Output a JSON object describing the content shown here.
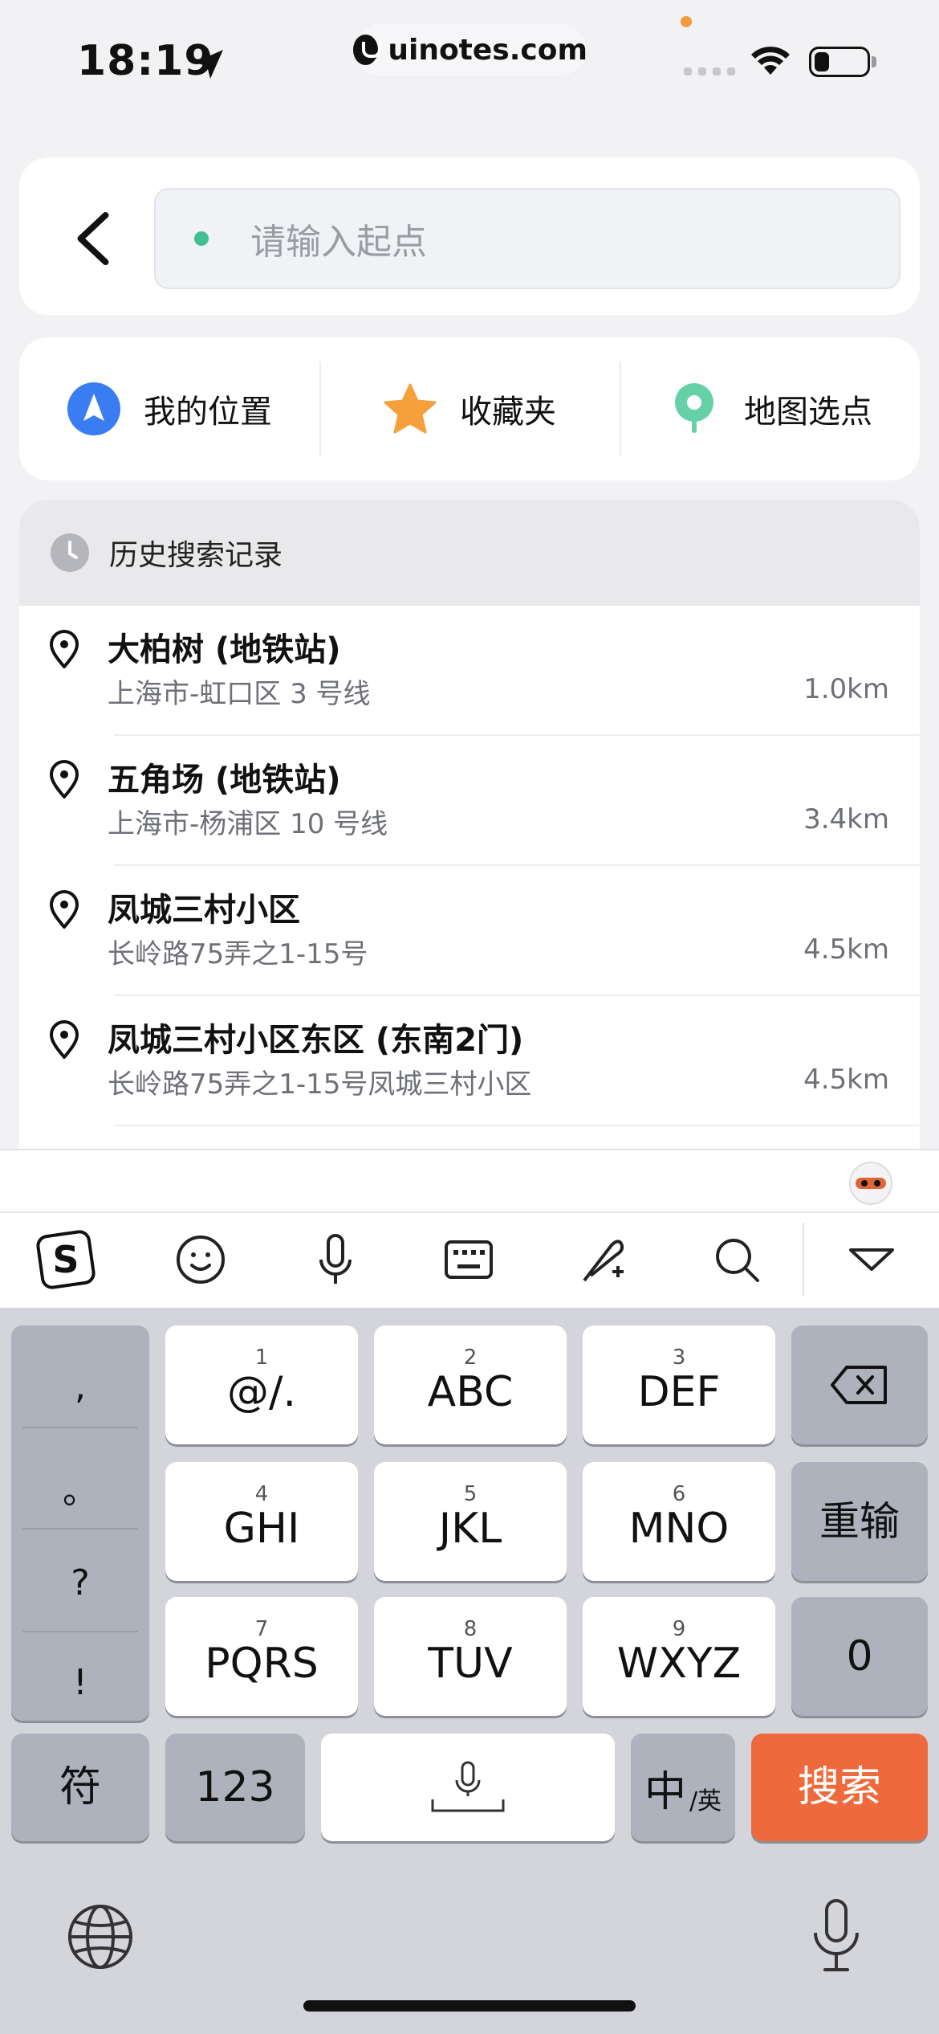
{
  "status_bar": {
    "time": "18:19",
    "url": "uinotes.com"
  },
  "search": {
    "placeholder": "请输入起点"
  },
  "quick_options": [
    {
      "label": "我的位置",
      "icon": "navigation-arrow-icon"
    },
    {
      "label": "收藏夹",
      "icon": "star-icon"
    },
    {
      "label": "地图选点",
      "icon": "map-pin-select-icon"
    }
  ],
  "history": {
    "title": "历史搜索记录",
    "items": [
      {
        "title": "大柏树 (地铁站)",
        "subtitle": "上海市-虹口区 3 号线",
        "distance": "1.0km"
      },
      {
        "title": "五角场 (地铁站)",
        "subtitle": "上海市-杨浦区 10 号线",
        "distance": "3.4km"
      },
      {
        "title": "凤城三村小区",
        "subtitle": "长岭路75弄之1-15号",
        "distance": "4.5km"
      },
      {
        "title": "凤城三村小区东区 (东南2门)",
        "subtitle": "长岭路75弄之1-15号凤城三村小区",
        "distance": "4.5km"
      }
    ]
  },
  "keyboard": {
    "punctuation": [
      ",",
      "。",
      "?",
      "!"
    ],
    "keys": [
      {
        "num": "1",
        "label": "@/."
      },
      {
        "num": "2",
        "label": "ABC"
      },
      {
        "num": "3",
        "label": "DEF"
      },
      {
        "num": "4",
        "label": "GHI"
      },
      {
        "num": "5",
        "label": "JKL"
      },
      {
        "num": "6",
        "label": "MNO"
      },
      {
        "num": "7",
        "label": "PQRS"
      },
      {
        "num": "8",
        "label": "TUV"
      },
      {
        "num": "9",
        "label": "WXYZ"
      }
    ],
    "reset_label": "重输",
    "zero_label": "0",
    "symbol_label": "符",
    "numeric_label": "123",
    "lang_main": "中",
    "lang_sub": "/英",
    "search_label": "搜索"
  },
  "colors": {
    "accent": "#ee6a3c",
    "origin_dot": "#3fbf92",
    "nav_blue": "#3a7df2",
    "star": "#f5a03a",
    "pin_green": "#66d1a6"
  }
}
